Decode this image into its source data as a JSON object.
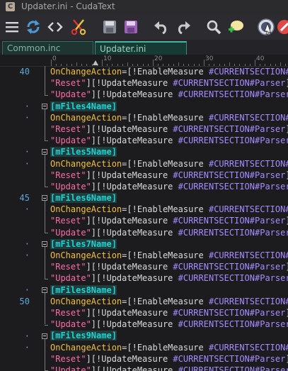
{
  "window": {
    "title": "Updater.ini - CudaText",
    "app_letter": "C"
  },
  "toolbar": {
    "buttons": [
      {
        "name": "menu-icon"
      },
      {
        "name": "refresh-icon"
      },
      {
        "name": "code-tags-icon"
      },
      {
        "name": "cut-icon"
      },
      {
        "name": "save-icon"
      },
      {
        "name": "save-all-icon"
      },
      {
        "name": "undo-icon"
      },
      {
        "name": "redo-icon"
      },
      {
        "name": "find-icon"
      },
      {
        "name": "comment-add-icon"
      },
      {
        "name": "plugin-icon"
      },
      {
        "name": "stop-icon"
      }
    ]
  },
  "tabs": [
    {
      "label": "Common.inc",
      "active": false
    },
    {
      "label": "Updater.ini",
      "active": true
    }
  ],
  "ruler": {
    "labels": [
      "0",
      "10",
      "20",
      "30",
      "40"
    ]
  },
  "editor": {
    "lines": [
      {
        "num": "40",
        "fold": "",
        "segs": [
          [
            "k",
            "OnChangeAction"
          ],
          [
            "s",
            "=[!EnableMeasure "
          ],
          [
            "v",
            "#CURRENTSECTION#P"
          ]
        ]
      },
      {
        "num": "",
        "fold": "",
        "segs": [
          [
            "q",
            "\"Reset\""
          ],
          [
            "s",
            "][!UpdateMeasure "
          ],
          [
            "v",
            "#CURRENTSECTION#Parser"
          ],
          [
            "s",
            "]["
          ]
        ]
      },
      {
        "num": "",
        "fold": "end",
        "segs": [
          [
            "q",
            "\"Update\""
          ],
          [
            "s",
            "][!UpdateMeasure "
          ],
          [
            "v",
            "#CURRENTSECTION#Parser"
          ],
          [
            "s",
            "]"
          ]
        ]
      },
      {
        "num": "·",
        "fold": "box",
        "segs": [
          [
            "h",
            "[mFiles4Name]"
          ]
        ]
      },
      {
        "num": "·",
        "fold": "",
        "segs": [
          [
            "k",
            "OnChangeAction"
          ],
          [
            "s",
            "=[!EnableMeasure "
          ],
          [
            "v",
            "#CURRENTSECTION#P"
          ]
        ]
      },
      {
        "num": "",
        "fold": "",
        "segs": [
          [
            "q",
            "\"Reset\""
          ],
          [
            "s",
            "][!UpdateMeasure "
          ],
          [
            "v",
            "#CURRENTSECTION#Parser"
          ],
          [
            "s",
            "]["
          ]
        ]
      },
      {
        "num": "",
        "fold": "end",
        "segs": [
          [
            "q",
            "\"Update\""
          ],
          [
            "s",
            "][!UpdateMeasure "
          ],
          [
            "v",
            "#CURRENTSECTION#Parser"
          ],
          [
            "s",
            "]"
          ]
        ]
      },
      {
        "num": "·",
        "fold": "box",
        "segs": [
          [
            "h",
            "[mFiles5Name]"
          ]
        ]
      },
      {
        "num": "·",
        "fold": "",
        "segs": [
          [
            "k",
            "OnChangeAction"
          ],
          [
            "s",
            "=[!EnableMeasure "
          ],
          [
            "v",
            "#CURRENTSECTION#P"
          ]
        ]
      },
      {
        "num": "",
        "fold": "",
        "segs": [
          [
            "q",
            "\"Reset\""
          ],
          [
            "s",
            "][!UpdateMeasure "
          ],
          [
            "v",
            "#CURRENTSECTION#Parser"
          ],
          [
            "s",
            "]["
          ]
        ]
      },
      {
        "num": "",
        "fold": "end",
        "segs": [
          [
            "q",
            "\"Update\""
          ],
          [
            "s",
            "][!UpdateMeasure "
          ],
          [
            "v",
            "#CURRENTSECTION#Parser"
          ],
          [
            "s",
            "]"
          ]
        ]
      },
      {
        "num": "45",
        "fold": "box",
        "segs": [
          [
            "h",
            "[mFiles6Name]"
          ]
        ]
      },
      {
        "num": "·",
        "fold": "",
        "segs": [
          [
            "k",
            "OnChangeAction"
          ],
          [
            "s",
            "=[!EnableMeasure "
          ],
          [
            "v",
            "#CURRENTSECTION#P"
          ]
        ]
      },
      {
        "num": "",
        "fold": "",
        "segs": [
          [
            "q",
            "\"Reset\""
          ],
          [
            "s",
            "][!UpdateMeasure "
          ],
          [
            "v",
            "#CURRENTSECTION#Parser"
          ],
          [
            "s",
            "]["
          ]
        ]
      },
      {
        "num": "",
        "fold": "end",
        "segs": [
          [
            "q",
            "\"Update\""
          ],
          [
            "s",
            "][!UpdateMeasure "
          ],
          [
            "v",
            "#CURRENTSECTION#Parser"
          ],
          [
            "s",
            "]"
          ]
        ]
      },
      {
        "num": "·",
        "fold": "box",
        "segs": [
          [
            "h",
            "[mFiles7Name]"
          ]
        ]
      },
      {
        "num": "·",
        "fold": "",
        "segs": [
          [
            "k",
            "OnChangeAction"
          ],
          [
            "s",
            "=[!EnableMeasure "
          ],
          [
            "v",
            "#CURRENTSECTION#P"
          ]
        ]
      },
      {
        "num": "",
        "fold": "",
        "segs": [
          [
            "q",
            "\"Reset\""
          ],
          [
            "s",
            "][!UpdateMeasure "
          ],
          [
            "v",
            "#CURRENTSECTION#Parser"
          ],
          [
            "s",
            "]["
          ]
        ]
      },
      {
        "num": "",
        "fold": "end",
        "segs": [
          [
            "q",
            "\"Update\""
          ],
          [
            "s",
            "][!UpdateMeasure "
          ],
          [
            "v",
            "#CURRENTSECTION#Parser"
          ],
          [
            "s",
            "]"
          ]
        ]
      },
      {
        "num": "·",
        "fold": "box",
        "segs": [
          [
            "h",
            "[mFiles8Name]"
          ]
        ]
      },
      {
        "num": "50",
        "fold": "",
        "segs": [
          [
            "k",
            "OnChangeAction"
          ],
          [
            "s",
            "=[!EnableMeasure "
          ],
          [
            "v",
            "#CURRENTSECTION#P"
          ]
        ]
      },
      {
        "num": "",
        "fold": "",
        "segs": [
          [
            "q",
            "\"Reset\""
          ],
          [
            "s",
            "][!UpdateMeasure "
          ],
          [
            "v",
            "#CURRENTSECTION#Parser"
          ],
          [
            "s",
            "]["
          ]
        ]
      },
      {
        "num": "",
        "fold": "end",
        "segs": [
          [
            "q",
            "\"Update\""
          ],
          [
            "s",
            "][!UpdateMeasure "
          ],
          [
            "v",
            "#CURRENTSECTION#Parser"
          ],
          [
            "s",
            "]"
          ]
        ]
      },
      {
        "num": "·",
        "fold": "box",
        "segs": [
          [
            "h",
            "[mFiles9Name]"
          ]
        ]
      },
      {
        "num": "·",
        "fold": "",
        "segs": [
          [
            "k",
            "OnChangeAction"
          ],
          [
            "s",
            "=[!EnableMeasure "
          ],
          [
            "v",
            "#CURRENTSECTION#P"
          ]
        ]
      },
      {
        "num": "",
        "fold": "",
        "segs": [
          [
            "q",
            "\"Reset\""
          ],
          [
            "s",
            "][!UpdateMeasure "
          ],
          [
            "v",
            "#CURRENTSECTION#Parser"
          ],
          [
            "s",
            "]["
          ]
        ]
      },
      {
        "num": "",
        "fold": "end",
        "segs": [
          [
            "q",
            "\"Update\""
          ],
          [
            "s",
            "][!UpdateMeasure "
          ],
          [
            "v",
            "#CURRENTSECTION#Parser"
          ],
          [
            "s",
            "]"
          ]
        ]
      }
    ]
  },
  "colors": {
    "keyword": "#f3c03a",
    "string": "#ff6aa9",
    "variable": "#a68cff",
    "section": "#1fd2d2",
    "line_number": "#5aa7d6",
    "tab_accent": "#4ab3a1"
  }
}
